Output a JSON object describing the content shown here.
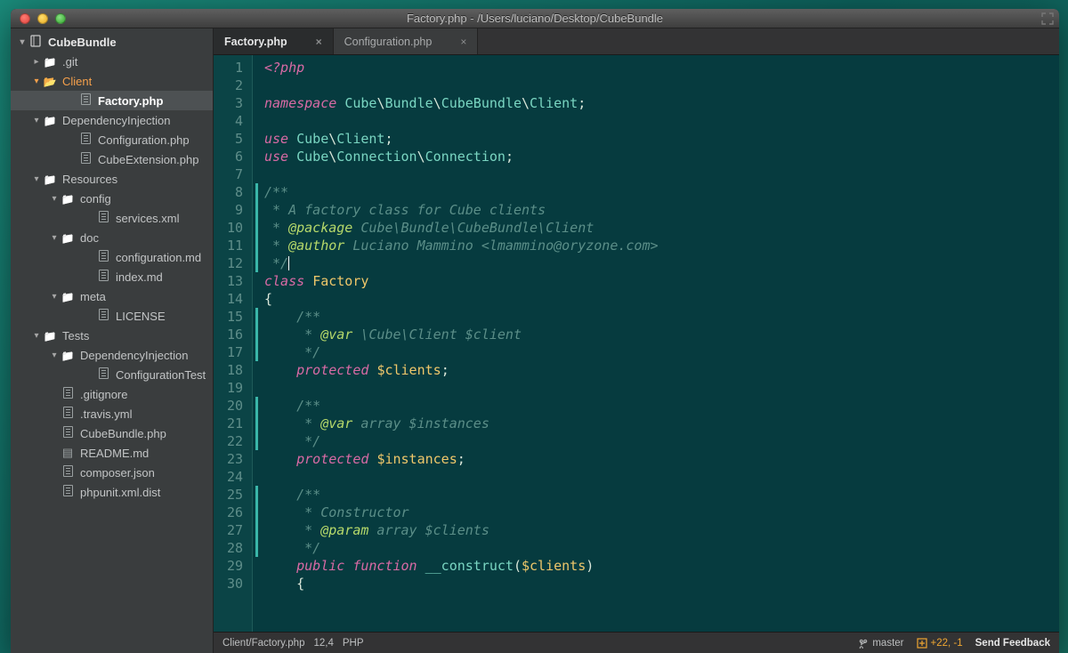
{
  "titlebar": {
    "title": "Factory.php - /Users/luciano/Desktop/CubeBundle"
  },
  "sidebar": {
    "project_name": "CubeBundle",
    "items": [
      {
        "indent": 24,
        "icon": "chev-right",
        "kind": "folder",
        "label": ".git"
      },
      {
        "indent": 24,
        "icon": "chev-down",
        "kind": "folder-open",
        "label": "Client",
        "orange": true
      },
      {
        "indent": 64,
        "icon": "",
        "kind": "file",
        "label": "Factory.php",
        "active": true
      },
      {
        "indent": 24,
        "icon": "chev-down",
        "kind": "folder",
        "label": "DependencyInjection"
      },
      {
        "indent": 64,
        "icon": "",
        "kind": "file",
        "label": "Configuration.php"
      },
      {
        "indent": 64,
        "icon": "",
        "kind": "file",
        "label": "CubeExtension.php"
      },
      {
        "indent": 24,
        "icon": "chev-down",
        "kind": "folder",
        "label": "Resources"
      },
      {
        "indent": 44,
        "icon": "chev-down",
        "kind": "folder",
        "label": "config"
      },
      {
        "indent": 84,
        "icon": "",
        "kind": "file",
        "label": "services.xml"
      },
      {
        "indent": 44,
        "icon": "chev-down",
        "kind": "folder",
        "label": "doc"
      },
      {
        "indent": 84,
        "icon": "",
        "kind": "file",
        "label": "configuration.md"
      },
      {
        "indent": 84,
        "icon": "",
        "kind": "file",
        "label": "index.md"
      },
      {
        "indent": 44,
        "icon": "chev-down",
        "kind": "folder",
        "label": "meta"
      },
      {
        "indent": 84,
        "icon": "",
        "kind": "file",
        "label": "LICENSE"
      },
      {
        "indent": 24,
        "icon": "chev-down",
        "kind": "folder",
        "label": "Tests"
      },
      {
        "indent": 44,
        "icon": "chev-down",
        "kind": "folder",
        "label": "DependencyInjection"
      },
      {
        "indent": 84,
        "icon": "",
        "kind": "file",
        "label": "ConfigurationTest"
      },
      {
        "indent": 44,
        "icon": "",
        "kind": "file",
        "label": ".gitignore"
      },
      {
        "indent": 44,
        "icon": "",
        "kind": "file",
        "label": ".travis.yml"
      },
      {
        "indent": 44,
        "icon": "",
        "kind": "file",
        "label": "CubeBundle.php"
      },
      {
        "indent": 44,
        "icon": "",
        "kind": "book",
        "label": "README.md"
      },
      {
        "indent": 44,
        "icon": "",
        "kind": "file",
        "label": "composer.json"
      },
      {
        "indent": 44,
        "icon": "",
        "kind": "file",
        "label": "phpunit.xml.dist"
      }
    ]
  },
  "tabs": [
    {
      "label": "Factory.php",
      "active": true
    },
    {
      "label": "Configuration.php",
      "active": false
    }
  ],
  "code": {
    "lines": [
      {
        "n": 1,
        "mod": false,
        "html": "<span class='kw'>&lt;?php</span>"
      },
      {
        "n": 2,
        "mod": false,
        "html": ""
      },
      {
        "n": 3,
        "mod": false,
        "html": "<span class='kw'>namespace</span> <span class='ns'>Cube</span><span class='sep'>\\</span><span class='ns'>Bundle</span><span class='sep'>\\</span><span class='ns'>CubeBundle</span><span class='sep'>\\</span><span class='ns'>Client</span><span class='punct'>;</span>"
      },
      {
        "n": 4,
        "mod": false,
        "html": ""
      },
      {
        "n": 5,
        "mod": false,
        "html": "<span class='kw'>use</span> <span class='ns'>Cube</span><span class='sep'>\\</span><span class='ns'>Client</span><span class='punct'>;</span>"
      },
      {
        "n": 6,
        "mod": false,
        "html": "<span class='kw'>use</span> <span class='ns'>Cube</span><span class='sep'>\\</span><span class='ns'>Connection</span><span class='sep'>\\</span><span class='ns'>Connection</span><span class='punct'>;</span>"
      },
      {
        "n": 7,
        "mod": false,
        "html": ""
      },
      {
        "n": 8,
        "mod": true,
        "html": "<span class='com'>/**</span>"
      },
      {
        "n": 9,
        "mod": true,
        "html": "<span class='com'> * A factory class for Cube clients</span>"
      },
      {
        "n": 10,
        "mod": true,
        "html": "<span class='com'> * </span><span class='ann'>@package</span><span class='com'> Cube\\Bundle\\CubeBundle\\Client</span>"
      },
      {
        "n": 11,
        "mod": true,
        "html": "<span class='com'> * </span><span class='ann'>@author</span><span class='com'> Luciano Mammino &lt;lmammino@oryzone.com&gt;</span>"
      },
      {
        "n": 12,
        "mod": true,
        "html": "<span class='com'> */</span><span class='cursor'></span>"
      },
      {
        "n": 13,
        "mod": false,
        "html": "<span class='kw'>class</span> <span class='cls'>Factory</span>"
      },
      {
        "n": 14,
        "mod": false,
        "html": "<span class='punct'>{</span>"
      },
      {
        "n": 15,
        "mod": true,
        "html": "    <span class='com'>/**</span>"
      },
      {
        "n": 16,
        "mod": true,
        "html": "    <span class='com'> * </span><span class='ann'>@var</span><span class='com'> \\Cube\\Client $client</span>"
      },
      {
        "n": 17,
        "mod": true,
        "html": "    <span class='com'> */</span>"
      },
      {
        "n": 18,
        "mod": false,
        "html": "    <span class='kw'>protected</span> <span class='var'>$clients</span><span class='punct'>;</span>"
      },
      {
        "n": 19,
        "mod": false,
        "html": ""
      },
      {
        "n": 20,
        "mod": true,
        "html": "    <span class='com'>/**</span>"
      },
      {
        "n": 21,
        "mod": true,
        "html": "    <span class='com'> * </span><span class='ann'>@var</span><span class='com'> array $instances</span>"
      },
      {
        "n": 22,
        "mod": true,
        "html": "    <span class='com'> */</span>"
      },
      {
        "n": 23,
        "mod": false,
        "html": "    <span class='kw'>protected</span> <span class='var'>$instances</span><span class='punct'>;</span>"
      },
      {
        "n": 24,
        "mod": false,
        "html": ""
      },
      {
        "n": 25,
        "mod": true,
        "html": "    <span class='com'>/**</span>"
      },
      {
        "n": 26,
        "mod": true,
        "html": "    <span class='com'> * Constructor</span>"
      },
      {
        "n": 27,
        "mod": true,
        "html": "    <span class='com'> * </span><span class='ann'>@param</span><span class='com'> array $clients</span>"
      },
      {
        "n": 28,
        "mod": true,
        "html": "    <span class='com'> */</span>"
      },
      {
        "n": 29,
        "mod": false,
        "html": "    <span class='kw'>public</span> <span class='kw'>function</span> <span class='ns'>__construct</span><span class='punct'>(</span><span class='var'>$clients</span><span class='punct'>)</span>"
      },
      {
        "n": 30,
        "mod": false,
        "html": "    <span class='punct'>{</span>"
      }
    ]
  },
  "statusbar": {
    "path": "Client/Factory.php",
    "position": "12,4",
    "language": "PHP",
    "branch": "master",
    "diff": "+22, -1",
    "feedback": "Send Feedback"
  }
}
